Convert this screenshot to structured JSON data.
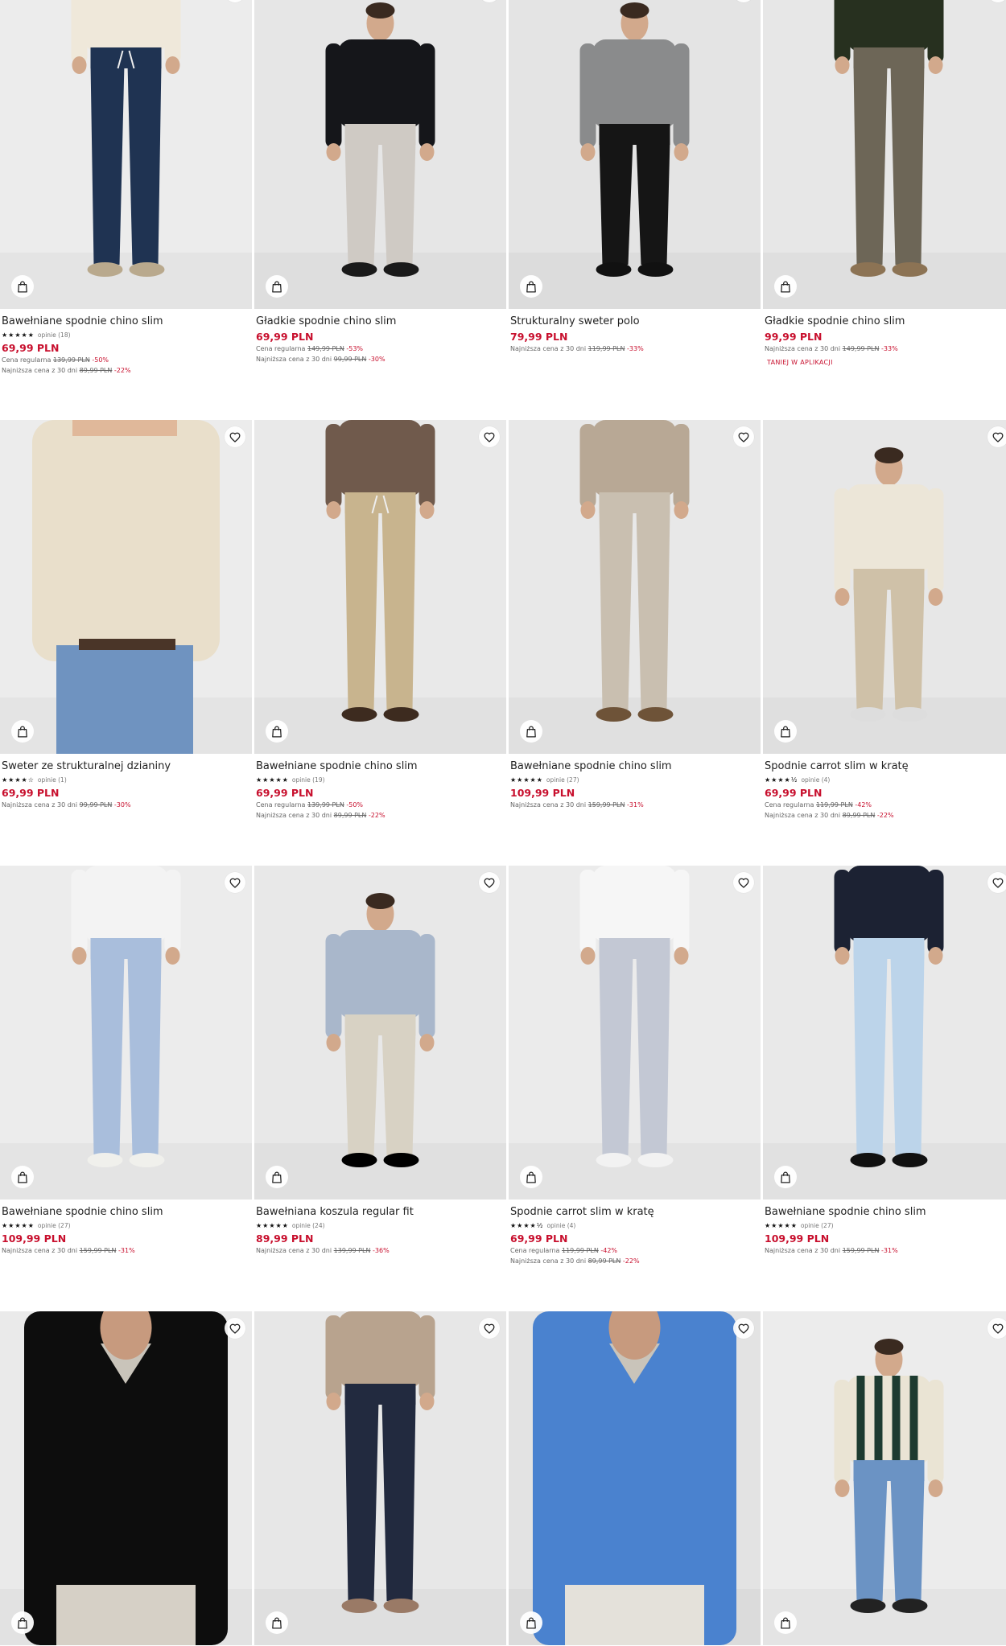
{
  "colors": {
    "price": "#c8102e",
    "background": "#ffffff"
  },
  "products": [
    {
      "title": "Bawełniane spodnie chino slim",
      "stars": "★★★★★",
      "reviews": "opinie (18)",
      "price": "69,99 PLN",
      "regular": {
        "label": "Cena regularna",
        "old": "139,99 PLN",
        "disc": "-50%"
      },
      "lowest": {
        "label": "Najniższa cena z 30 dni",
        "old": "89,99 PLN",
        "disc": "-22%"
      },
      "promo": ""
    },
    {
      "title": "Gładkie spodnie chino slim",
      "stars": "",
      "reviews": "",
      "price": "69,99 PLN",
      "regular": {
        "label": "Cena regularna",
        "old": "149,99 PLN",
        "disc": "-53%"
      },
      "lowest": {
        "label": "Najniższa cena z 30 dni",
        "old": "99,99 PLN",
        "disc": "-30%"
      },
      "promo": ""
    },
    {
      "title": "Strukturalny sweter polo",
      "stars": "",
      "reviews": "",
      "price": "79,99 PLN",
      "regular": null,
      "lowest": {
        "label": "Najniższa cena z 30 dni",
        "old": "119,99 PLN",
        "disc": "-33%"
      },
      "promo": ""
    },
    {
      "title": "Gładkie spodnie chino slim",
      "stars": "",
      "reviews": "",
      "price": "99,99 PLN",
      "regular": null,
      "lowest": {
        "label": "Najniższa cena z 30 dni",
        "old": "149,99 PLN",
        "disc": "-33%"
      },
      "promo": "TANIEJ W APLIKACJI"
    },
    {
      "title": "Sweter ze strukturalnej dzianiny",
      "stars": "★★★★☆",
      "reviews": "opinie (1)",
      "price": "69,99 PLN",
      "regular": null,
      "lowest": {
        "label": "Najniższa cena z 30 dni",
        "old": "99,99 PLN",
        "disc": "-30%"
      },
      "promo": ""
    },
    {
      "title": "Bawełniane spodnie chino slim",
      "stars": "★★★★★",
      "reviews": "opinie (19)",
      "price": "69,99 PLN",
      "regular": {
        "label": "Cena regularna",
        "old": "139,99 PLN",
        "disc": "-50%"
      },
      "lowest": {
        "label": "Najniższa cena z 30 dni",
        "old": "89,99 PLN",
        "disc": "-22%"
      },
      "promo": ""
    },
    {
      "title": "Bawełniane spodnie chino slim",
      "stars": "★★★★★",
      "reviews": "opinie (27)",
      "price": "109,99 PLN",
      "regular": null,
      "lowest": {
        "label": "Najniższa cena z 30 dni",
        "old": "159,99 PLN",
        "disc": "-31%"
      },
      "promo": ""
    },
    {
      "title": "Spodnie carrot slim w kratę",
      "stars": "★★★★½",
      "reviews": "opinie (4)",
      "price": "69,99 PLN",
      "regular": {
        "label": "Cena regularna",
        "old": "119,99 PLN",
        "disc": "-42%"
      },
      "lowest": {
        "label": "Najniższa cena z 30 dni",
        "old": "89,99 PLN",
        "disc": "-22%"
      },
      "promo": ""
    },
    {
      "title": "Bawełniane spodnie chino slim",
      "stars": "★★★★★",
      "reviews": "opinie (27)",
      "price": "109,99 PLN",
      "regular": null,
      "lowest": {
        "label": "Najniższa cena z 30 dni",
        "old": "159,99 PLN",
        "disc": "-31%"
      },
      "promo": ""
    },
    {
      "title": "Bawełniana koszula regular fit",
      "stars": "★★★★★",
      "reviews": "opinie (24)",
      "price": "89,99 PLN",
      "regular": null,
      "lowest": {
        "label": "Najniższa cena z 30 dni",
        "old": "139,99 PLN",
        "disc": "-36%"
      },
      "promo": ""
    },
    {
      "title": "Spodnie carrot slim w kratę",
      "stars": "★★★★½",
      "reviews": "opinie (4)",
      "price": "69,99 PLN",
      "regular": {
        "label": "Cena regularna",
        "old": "119,99 PLN",
        "disc": "-42%"
      },
      "lowest": {
        "label": "Najniższa cena z 30 dni",
        "old": "89,99 PLN",
        "disc": "-22%"
      },
      "promo": ""
    },
    {
      "title": "Bawełniane spodnie chino slim",
      "stars": "★★★★★",
      "reviews": "opinie (27)",
      "price": "109,99 PLN",
      "regular": null,
      "lowest": {
        "label": "Najniższa cena z 30 dni",
        "old": "159,99 PLN",
        "disc": "-31%"
      },
      "promo": ""
    },
    {
      "title": "",
      "stars": "",
      "reviews": "",
      "price": "",
      "regular": null,
      "lowest": null,
      "promo": ""
    },
    {
      "title": "",
      "stars": "",
      "reviews": "",
      "price": "",
      "regular": null,
      "lowest": null,
      "promo": ""
    },
    {
      "title": "",
      "stars": "",
      "reviews": "",
      "price": "",
      "regular": null,
      "lowest": null,
      "promo": ""
    },
    {
      "title": "",
      "stars": "",
      "reviews": "",
      "price": "",
      "regular": null,
      "lowest": null,
      "promo": ""
    }
  ]
}
